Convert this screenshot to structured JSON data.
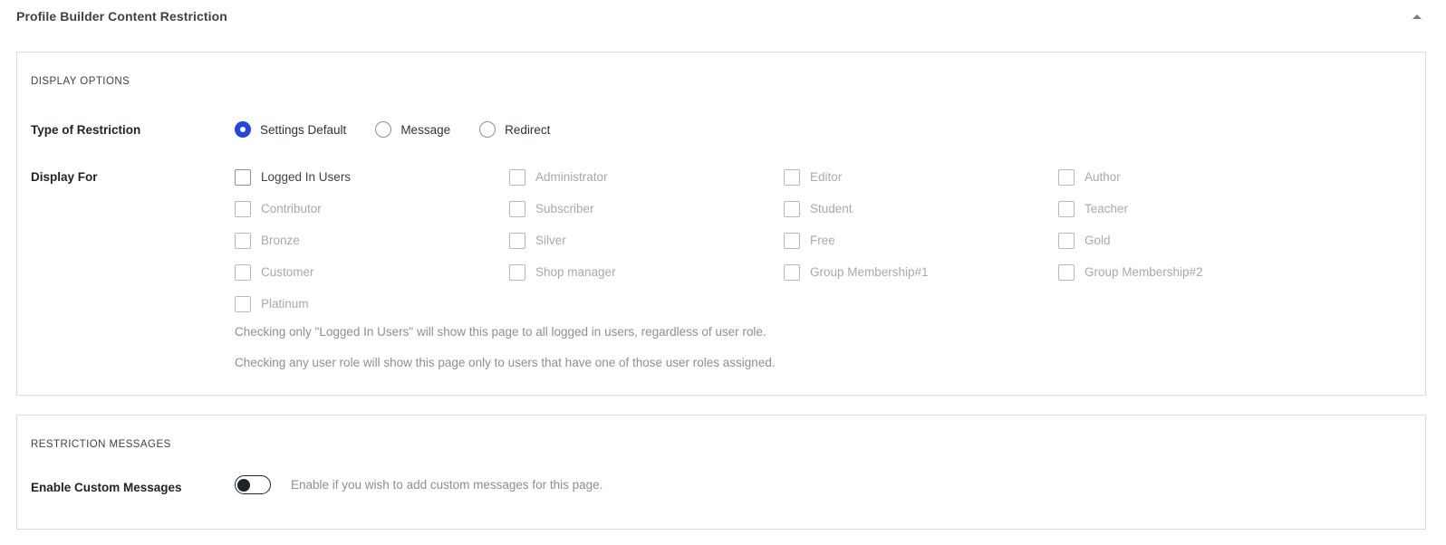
{
  "metabox": {
    "title": "Profile Builder Content Restriction",
    "collapse_icon": "caret-up-icon"
  },
  "display_options": {
    "section_label": "DISPLAY OPTIONS",
    "type_of_restriction": {
      "label": "Type of Restriction",
      "selected": "Settings Default",
      "options": [
        {
          "label": "Settings Default",
          "checked": true
        },
        {
          "label": "Message",
          "checked": false
        },
        {
          "label": "Redirect",
          "checked": false
        }
      ]
    },
    "display_for": {
      "label": "Display For",
      "rows": [
        [
          {
            "label": "Logged In Users",
            "checked": false,
            "enabled": true
          },
          {
            "label": "Administrator",
            "checked": false,
            "enabled": false
          },
          {
            "label": "Editor",
            "checked": false,
            "enabled": false
          },
          {
            "label": "Author",
            "checked": false,
            "enabled": false
          }
        ],
        [
          {
            "label": "Contributor",
            "checked": false,
            "enabled": false
          },
          {
            "label": "Subscriber",
            "checked": false,
            "enabled": false
          },
          {
            "label": "Student",
            "checked": false,
            "enabled": false
          },
          {
            "label": "Teacher",
            "checked": false,
            "enabled": false
          }
        ],
        [
          {
            "label": "Bronze",
            "checked": false,
            "enabled": false
          },
          {
            "label": "Silver",
            "checked": false,
            "enabled": false
          },
          {
            "label": "Free",
            "checked": false,
            "enabled": false
          },
          {
            "label": "Gold",
            "checked": false,
            "enabled": false
          }
        ],
        [
          {
            "label": "Customer",
            "checked": false,
            "enabled": false
          },
          {
            "label": "Shop manager",
            "checked": false,
            "enabled": false
          },
          {
            "label": "Group Membership#1",
            "checked": false,
            "enabled": false
          },
          {
            "label": "Group Membership#2",
            "checked": false,
            "enabled": false
          }
        ],
        [
          {
            "label": "Platinum",
            "checked": false,
            "enabled": false
          },
          {
            "label": "",
            "checked": false,
            "enabled": false
          },
          {
            "label": "",
            "checked": false,
            "enabled": false
          },
          {
            "label": "",
            "checked": false,
            "enabled": false
          }
        ]
      ],
      "notes": [
        "Checking only \"Logged In Users\" will show this page to all logged in users, regardless of user role.",
        "Checking any user role will show this page only to users that have one of those user roles assigned."
      ]
    }
  },
  "restriction_messages": {
    "section_label": "RESTRICTION MESSAGES",
    "enable_custom_messages": {
      "label": "Enable Custom Messages",
      "enabled": false,
      "description": "Enable if you wish to add custom messages for this page."
    }
  },
  "colors": {
    "accent": "#2145e6",
    "panel_border": "#dcdcde",
    "text_primary": "#1d2327",
    "text_muted": "#8c8f94",
    "text_disabled": "#a7aaad"
  }
}
